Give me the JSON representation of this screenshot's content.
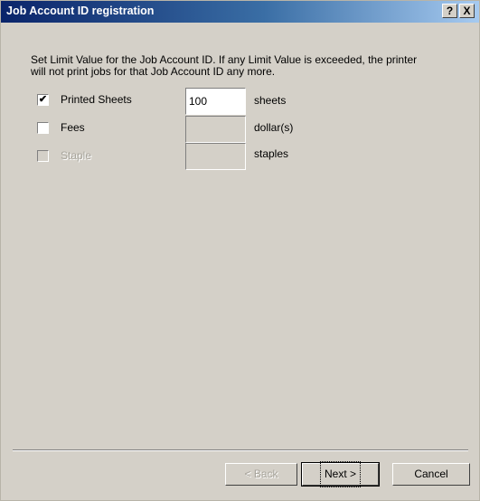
{
  "window": {
    "title": "Job Account ID registration",
    "help_label": "?",
    "close_label": "X"
  },
  "description": "Set Limit Value for the Job Account ID.  If any Limit Value is exceeded, the printer will not print jobs for that Job Account ID any more.",
  "limits": [
    {
      "label": "Printed Sheets",
      "checked": true,
      "enabled": true,
      "value": "100",
      "unit": "sheets",
      "check_glyph": "✔"
    },
    {
      "label": "Fees",
      "checked": false,
      "enabled": true,
      "value": "",
      "unit": "dollar(s)",
      "check_glyph": ""
    },
    {
      "label": "Staple",
      "checked": false,
      "enabled": false,
      "value": "",
      "unit": "staples",
      "check_glyph": ""
    }
  ],
  "buttons": {
    "back": "< Back",
    "next": "Next >",
    "cancel": "Cancel"
  },
  "colors": {
    "dialog_bg": "#d4d0c8",
    "title_start": "#0a246a",
    "title_end": "#a6caf0"
  }
}
